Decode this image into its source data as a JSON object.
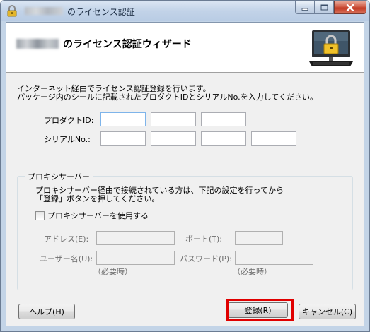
{
  "window": {
    "title": "のライセンス認証"
  },
  "header": {
    "title": "のライセンス認証ウィザード"
  },
  "instructions": {
    "line1": "インターネット経由でライセンス認証登録を行います。",
    "line2": "パッケージ内のシールに記載されたプロダクトIDとシリアルNo.を入力してください。"
  },
  "product_id": {
    "label": "プロダクトID:"
  },
  "serial_no": {
    "label": "シリアルNo.:"
  },
  "proxy": {
    "group_title": "プロキシサーバー",
    "desc_line1": "プロキシサーバー経由で接続されている方は、下記の設定を行ってから",
    "desc_line2": "「登録」ボタンを押してください。",
    "checkbox_label": "プロキシサーバーを使用する",
    "address_label": "アドレス(E):",
    "port_label": "ポート(T):",
    "username_label": "ユーザー名(U):",
    "password_label": "パスワード(P):",
    "optional_note": "（必要時）"
  },
  "buttons": {
    "help": "ヘルプ(H)",
    "register": "登録(R)",
    "cancel": "キャンセル(C)"
  },
  "colors": {
    "highlight": "#e00000",
    "focus_border": "#7eb4ea"
  },
  "icons": {
    "title": "padlock-icon",
    "header": "monitor-padlock-icon",
    "minimize": "minimize-icon",
    "maximize": "maximize-icon",
    "close": "close-icon"
  }
}
